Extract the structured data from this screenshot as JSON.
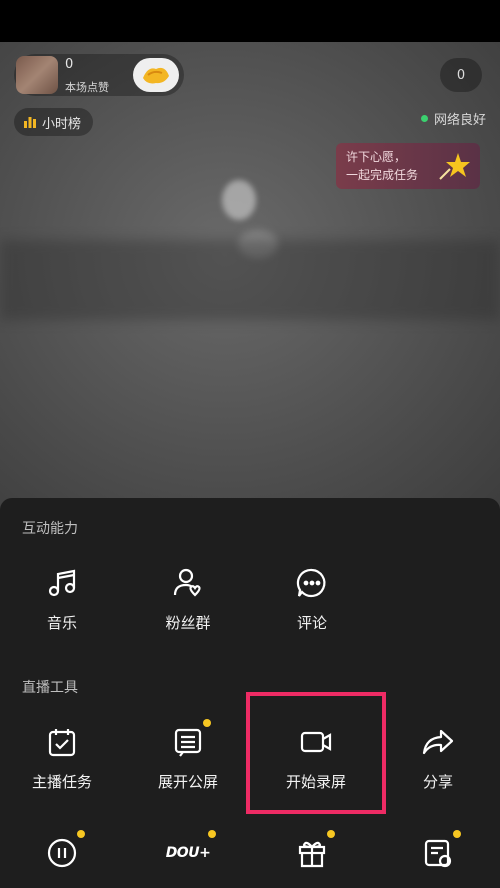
{
  "live": {
    "anchor_count": "0",
    "anchor_sub": "本场点赞",
    "viewer_count": "0",
    "hour_rank": "小时榜",
    "network_status": "网络良好",
    "wish_card": "许下心愿，\n一起完成任务"
  },
  "sheet": {
    "section_interact": "互动能力",
    "section_tools": "直播工具",
    "interact": [
      {
        "label": "音乐",
        "icon": "music-icon"
      },
      {
        "label": "粉丝群",
        "icon": "fan-group-icon"
      },
      {
        "label": "评论",
        "icon": "comment-icon"
      }
    ],
    "tools": [
      {
        "label": "主播任务",
        "icon": "task-calendar-icon"
      },
      {
        "label": "展开公屏",
        "icon": "public-screen-icon"
      },
      {
        "label": "开始录屏",
        "icon": "video-camera-icon"
      },
      {
        "label": "分享",
        "icon": "share-icon"
      }
    ],
    "bottom_icons": [
      "pause-icon",
      "dou-plus-icon",
      "gift-icon",
      "settings-card-icon"
    ],
    "bottom_dou_text": "DOU+"
  },
  "colors": {
    "highlight": "#ee2b64",
    "badge_dot": "#f7c722",
    "network_dot": "#3bd16f",
    "sheet_bg": "#1e1e1e"
  }
}
